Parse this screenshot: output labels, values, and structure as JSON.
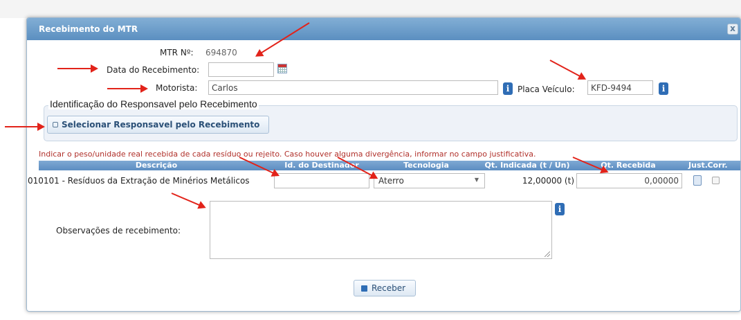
{
  "dialog": {
    "title": "Recebimento do MTR",
    "close_label": "x"
  },
  "form": {
    "mtr_label": "MTR Nº:",
    "mtr_value": "694870",
    "date_label": "Data do Recebimento:",
    "date_value": "",
    "driver_label": "Motorista:",
    "driver_value": "Carlos",
    "plate_label": "Placa Veículo:",
    "plate_value": "KFD-9494"
  },
  "responsible": {
    "legend": "Identificação do Responsavel pelo Recebimento",
    "select_button": "Selecionar Responsavel pelo Recebimento"
  },
  "hint": "Indicar o peso/unidade real recebida de cada resíduo ou rejeito. Caso houver alguma divergência, informar no campo justificativa.",
  "table": {
    "headers": [
      "Descrição",
      "Id. do Destinador",
      "Tecnologia",
      "Qt. Indicada (t / Un)",
      "Qt. Recebida",
      "Just.",
      "Corr."
    ],
    "rows": [
      {
        "description": "010101 - Resíduos da Extração de Minérios Metálicos",
        "destinador_id": "",
        "technology": "Aterro",
        "qt_indicada": "12,00000 (t)",
        "qt_recebida": "0,00000"
      }
    ]
  },
  "observations": {
    "label": "Observações de recebimento:",
    "value": ""
  },
  "actions": {
    "receive": "Receber"
  },
  "colors": {
    "titlebar": "#5b8fc0",
    "header": "#6b9bcb",
    "hint_text": "#b0302a",
    "annotation_arrow": "#e2231a"
  },
  "icons": [
    "close-icon",
    "calendar-icon",
    "info-icon",
    "document-icon",
    "receive-icon"
  ]
}
